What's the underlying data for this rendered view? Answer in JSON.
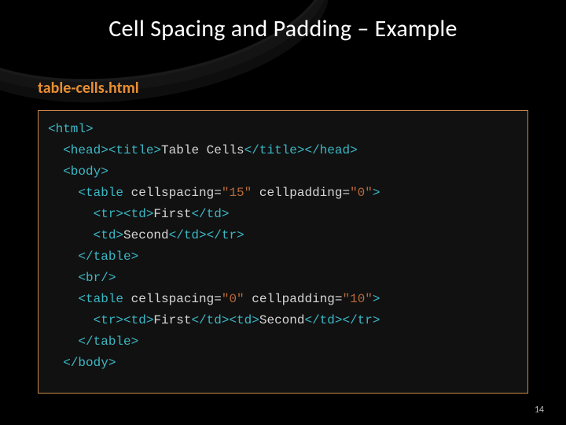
{
  "slide": {
    "title": "Cell Spacing and Padding – Example",
    "filename": "table-cells.html",
    "page_number": "14"
  },
  "code": {
    "lines": [
      [
        {
          "c": "t-tag",
          "t": "<html>"
        }
      ],
      [
        {
          "c": "indent",
          "t": "  "
        },
        {
          "c": "t-tag",
          "t": "<head><title>"
        },
        {
          "c": "t-text",
          "t": "Table Cells"
        },
        {
          "c": "t-tag",
          "t": "</title></head>"
        }
      ],
      [
        {
          "c": "indent",
          "t": "  "
        },
        {
          "c": "t-tag",
          "t": "<body>"
        }
      ],
      [
        {
          "c": "indent",
          "t": "    "
        },
        {
          "c": "t-tag",
          "t": "<table"
        },
        {
          "c": "t-attr",
          "t": " cellspacing="
        },
        {
          "c": "t-val",
          "t": "\"15\""
        },
        {
          "c": "t-attr",
          "t": " cellpadding="
        },
        {
          "c": "t-val",
          "t": "\"0\""
        },
        {
          "c": "t-tag",
          "t": ">"
        }
      ],
      [
        {
          "c": "indent",
          "t": "      "
        },
        {
          "c": "t-tag",
          "t": "<tr><td>"
        },
        {
          "c": "t-text",
          "t": "First"
        },
        {
          "c": "t-tag",
          "t": "</td>"
        }
      ],
      [
        {
          "c": "indent",
          "t": "      "
        },
        {
          "c": "t-tag",
          "t": "<td>"
        },
        {
          "c": "t-text",
          "t": "Second"
        },
        {
          "c": "t-tag",
          "t": "</td></tr>"
        }
      ],
      [
        {
          "c": "indent",
          "t": "    "
        },
        {
          "c": "t-tag",
          "t": "</table>"
        }
      ],
      [
        {
          "c": "indent",
          "t": "    "
        },
        {
          "c": "t-tag",
          "t": "<br/>"
        }
      ],
      [
        {
          "c": "indent",
          "t": "    "
        },
        {
          "c": "t-tag",
          "t": "<table"
        },
        {
          "c": "t-attr",
          "t": " cellspacing="
        },
        {
          "c": "t-val",
          "t": "\"0\""
        },
        {
          "c": "t-attr",
          "t": " cellpadding="
        },
        {
          "c": "t-val",
          "t": "\"10\""
        },
        {
          "c": "t-tag",
          "t": ">"
        }
      ],
      [
        {
          "c": "indent",
          "t": "      "
        },
        {
          "c": "t-tag",
          "t": "<tr><td>"
        },
        {
          "c": "t-text",
          "t": "First"
        },
        {
          "c": "t-tag",
          "t": "</td><td>"
        },
        {
          "c": "t-text",
          "t": "Second"
        },
        {
          "c": "t-tag",
          "t": "</td></tr>"
        }
      ],
      [
        {
          "c": "indent",
          "t": "    "
        },
        {
          "c": "t-tag",
          "t": "</table>"
        }
      ],
      [
        {
          "c": "indent",
          "t": "  "
        },
        {
          "c": "t-tag",
          "t": "</body>"
        }
      ]
    ]
  }
}
